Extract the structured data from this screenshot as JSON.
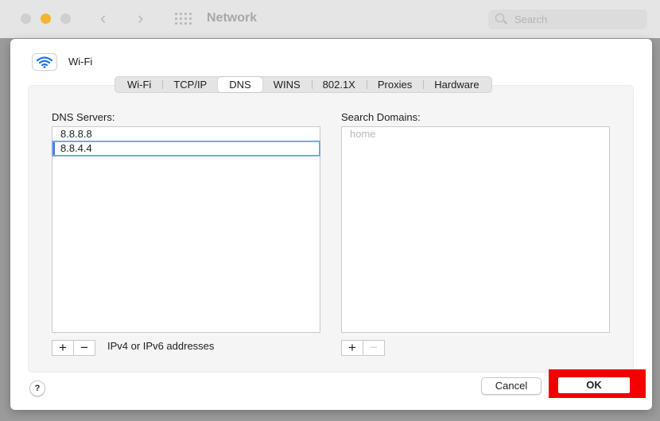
{
  "window": {
    "title": "Network",
    "search_placeholder": "Search"
  },
  "sheet": {
    "interface_name": "Wi-Fi",
    "tabs": [
      {
        "label": "Wi-Fi"
      },
      {
        "label": "TCP/IP"
      },
      {
        "label": "DNS"
      },
      {
        "label": "WINS"
      },
      {
        "label": "802.1X"
      },
      {
        "label": "Proxies"
      },
      {
        "label": "Hardware"
      }
    ],
    "active_tab": "DNS",
    "dns": {
      "label": "DNS Servers:",
      "servers": [
        "8.8.8.8",
        "8.8.4.4"
      ],
      "selected_index": 1,
      "hint": "IPv4 or IPv6 addresses"
    },
    "search_domains": {
      "label": "Search Domains:",
      "placeholder": "home"
    },
    "buttons": {
      "add": "+",
      "remove": "−",
      "help": "?",
      "cancel": "Cancel",
      "ok": "OK"
    }
  },
  "colors": {
    "highlight": "#f20000",
    "selection": "#3b78e0"
  }
}
